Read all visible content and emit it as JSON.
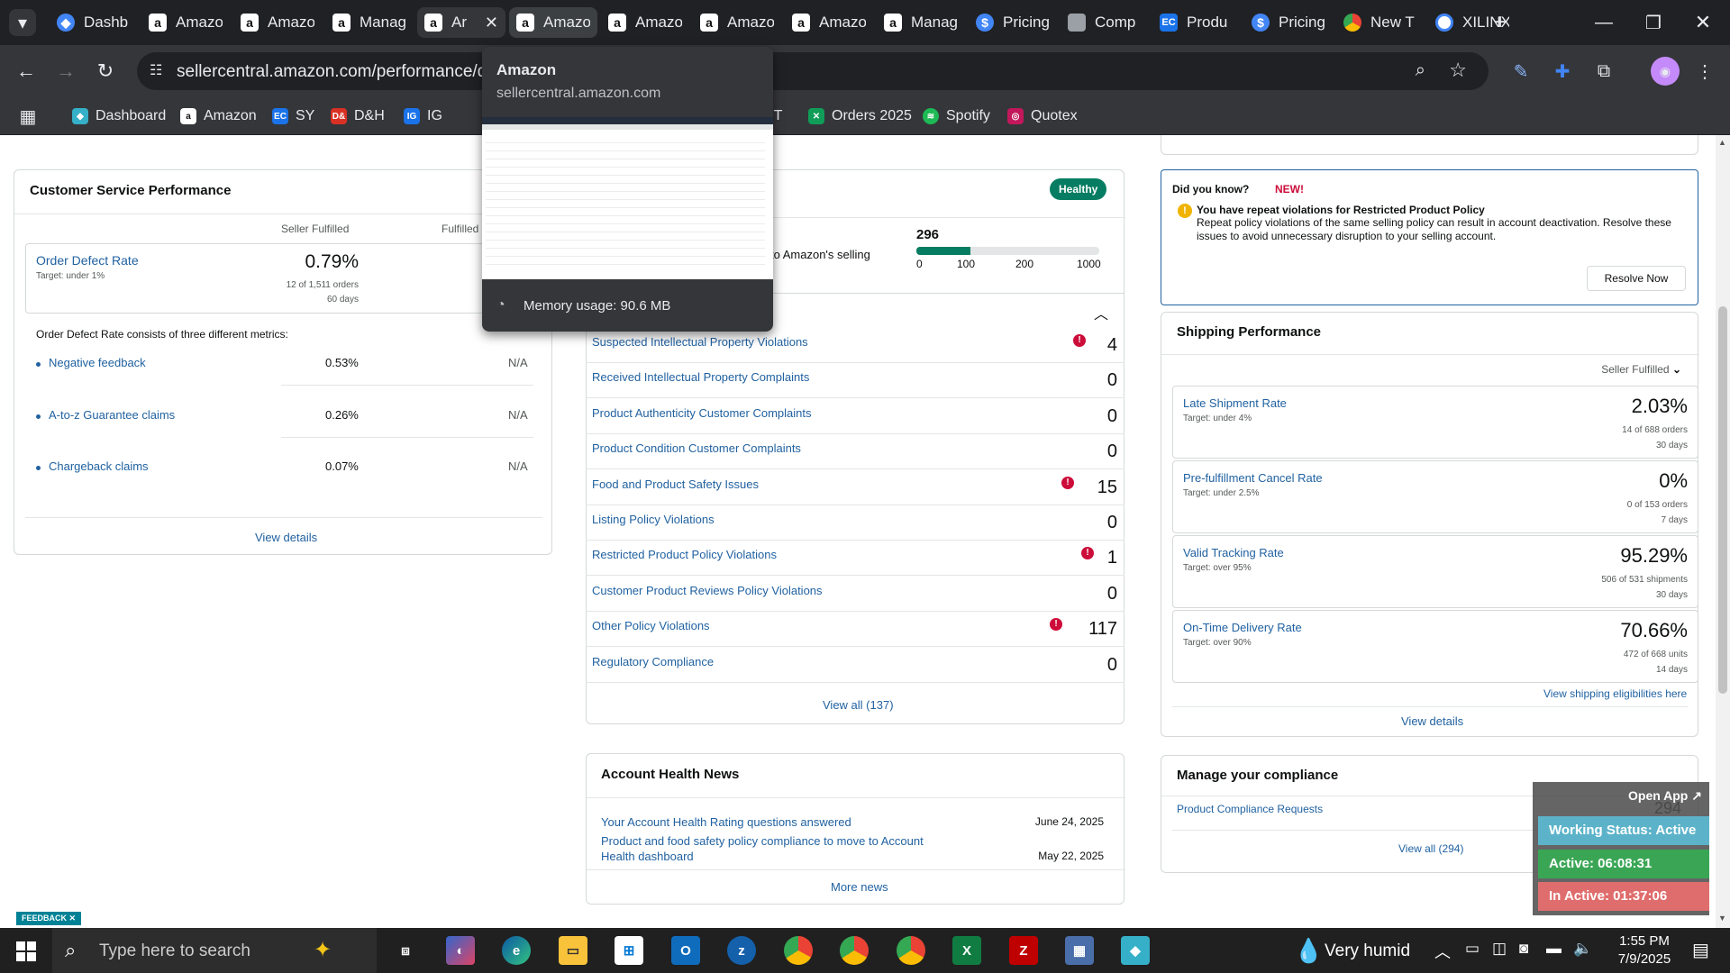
{
  "browser": {
    "tabs": [
      {
        "label": "Dashb",
        "icon": "dashboard-icon"
      },
      {
        "label": "Amazo",
        "icon": "amazon-icon"
      },
      {
        "label": "Amazo",
        "icon": "amazon-icon"
      },
      {
        "label": "Manag",
        "icon": "amazon-icon"
      },
      {
        "label": "Ar",
        "icon": "amazon-icon"
      },
      {
        "label": "Amazo",
        "icon": "amazon-icon"
      },
      {
        "label": "Amazo",
        "icon": "amazon-icon"
      },
      {
        "label": "Amazo",
        "icon": "amazon-icon"
      },
      {
        "label": "Amazo",
        "icon": "amazon-icon"
      },
      {
        "label": "Manag",
        "icon": "amazon-icon"
      },
      {
        "label": "Pricing",
        "icon": "dollar-icon"
      },
      {
        "label": "Comp",
        "icon": "app-icon"
      },
      {
        "label": "Produ",
        "icon": "ec-icon"
      },
      {
        "label": "Pricing",
        "icon": "dollar-icon"
      },
      {
        "label": "New T",
        "icon": "chrome-icon"
      },
      {
        "label": "XILINX",
        "icon": "google-icon"
      }
    ],
    "new_tab": "+",
    "url": "sellercentral.amazon.com/performance/dash",
    "bookmarks": [
      {
        "label": "Dashboard"
      },
      {
        "label": "Amazon"
      },
      {
        "label": "SY"
      },
      {
        "label": "D&H"
      },
      {
        "label": "IG"
      },
      {
        "label": "PT"
      },
      {
        "label": "Orders 2025"
      },
      {
        "label": "Spotify"
      },
      {
        "label": "Quotex"
      }
    ],
    "tab_tooltip": {
      "title": "Amazon",
      "domain": "sellercentral.amazon.com",
      "memory": "Memory usage: 90.6 MB"
    }
  },
  "csp": {
    "title": "Customer Service Performance",
    "col1": "Seller Fulfilled",
    "col2": "Fulfilled",
    "odr": {
      "label": "Order Defect Rate",
      "target": "Target: under 1%",
      "value": "0.79%",
      "orders": "12 of 1,511 orders",
      "days": "60 days"
    },
    "desc": "Order Defect Rate consists of three different metrics:",
    "metrics": [
      {
        "name": "Negative feedback",
        "v1": "0.53%",
        "v2": "N/A"
      },
      {
        "name": "A-to-z Guarantee claims",
        "v1": "0.26%",
        "v2": "N/A"
      },
      {
        "name": "Chargeback claims",
        "v1": "0.07%",
        "v2": "N/A"
      }
    ],
    "view_details": "View details"
  },
  "ahr": {
    "status": "Healthy",
    "score": "296",
    "scale": [
      "0",
      "100",
      "200",
      "1000"
    ],
    "partial_text": "to Amazon's selling",
    "score_fraction": 0.296
  },
  "violations": {
    "rows": [
      {
        "name": "Suspected Intellectual Property Violations",
        "count": "4",
        "warn": true
      },
      {
        "name": "Received Intellectual Property Complaints",
        "count": "0",
        "warn": false
      },
      {
        "name": "Product Authenticity Customer Complaints",
        "count": "0",
        "warn": false
      },
      {
        "name": "Product Condition Customer Complaints",
        "count": "0",
        "warn": false
      },
      {
        "name": "Food and Product Safety Issues",
        "count": "15",
        "warn": true
      },
      {
        "name": "Listing Policy Violations",
        "count": "0",
        "warn": false
      },
      {
        "name": "Restricted Product Policy Violations",
        "count": "1",
        "warn": true
      },
      {
        "name": "Customer Product Reviews Policy Violations",
        "count": "0",
        "warn": false
      },
      {
        "name": "Other Policy Violations",
        "count": "117",
        "warn": true
      },
      {
        "name": "Regulatory Compliance",
        "count": "0",
        "warn": false
      }
    ],
    "view_all": "View all (137)"
  },
  "news": {
    "title": "Account Health News",
    "items": [
      {
        "text": "Your Account Health Rating questions answered",
        "date": "June 24, 2025"
      },
      {
        "text": "Product and food safety policy compliance to move to Account Health dashboard",
        "date": "May 22, 2025"
      }
    ],
    "more": "More news"
  },
  "did_you_know": {
    "title": "Did you know?",
    "badge": "NEW!",
    "heading": "You have repeat violations for Restricted Product Policy",
    "body": "Repeat policy violations of the same selling policy can result in account deactivation. Resolve these issues to avoid unnecessary disruption to your selling account.",
    "button": "Resolve Now"
  },
  "shipping": {
    "title": "Shipping Performance",
    "filter": "Seller Fulfilled",
    "metrics": [
      {
        "name": "Late Shipment Rate",
        "target": "Target: under 4%",
        "value": "2.03%",
        "sub1": "14 of 688 orders",
        "sub2": "30 days"
      },
      {
        "name": "Pre-fulfillment Cancel Rate",
        "target": "Target: under 2.5%",
        "value": "0%",
        "sub1": "0 of 153 orders",
        "sub2": "7 days"
      },
      {
        "name": "Valid Tracking Rate",
        "target": "Target: over 95%",
        "value": "95.29%",
        "sub1": "506 of 531 shipments",
        "sub2": "30 days"
      },
      {
        "name": "On-Time Delivery Rate",
        "target": "Target: over 90%",
        "value": "70.66%",
        "sub1": "472 of 668 units",
        "sub2": "14 days"
      }
    ],
    "eligibilities": "View shipping eligibilities here",
    "view_details": "View details"
  },
  "compliance": {
    "title": "Manage your compliance",
    "item": "Product Compliance Requests",
    "count": "294",
    "view_all": "View all (294)"
  },
  "widget": {
    "open": "Open App",
    "status": "Working Status: Active",
    "active": "Active: 06:08:31",
    "inactive": "In Active: 01:37:06"
  },
  "feedback": "FEEDBACK",
  "taskbar": {
    "search": "Type here to search",
    "weather": "Very humid",
    "time": "1:55 PM",
    "date": "7/9/2025"
  },
  "colors": {
    "healthy": "#067d62",
    "link": "#2162a1",
    "warn": "#cc0c39",
    "new_badge": "#cc0c39",
    "status_active": "#5cb3c9",
    "active_green": "#3aa655",
    "inactive_red": "#e06d6d"
  }
}
